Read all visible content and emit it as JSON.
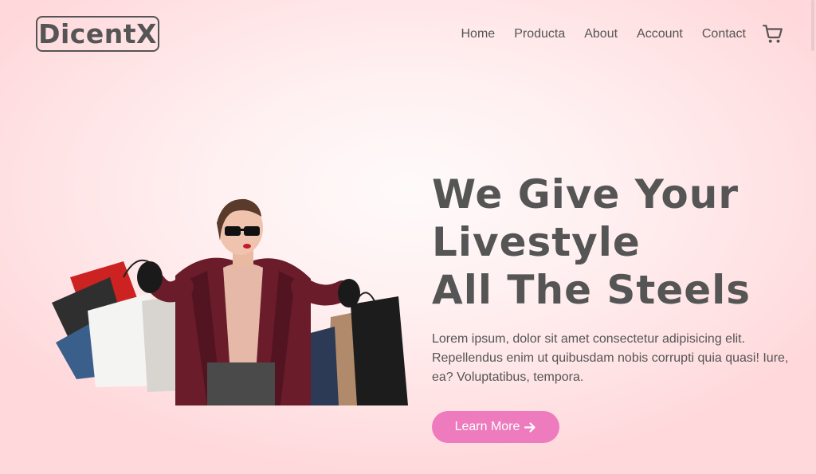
{
  "brand": {
    "logo_text": "DicentX"
  },
  "nav": {
    "items": [
      {
        "label": "Home"
      },
      {
        "label": "Producta"
      },
      {
        "label": "About"
      },
      {
        "label": "Account"
      },
      {
        "label": "Contact"
      }
    ],
    "cart_icon": "cart-icon"
  },
  "hero": {
    "title_lines": [
      "We Give Your",
      "Livestyle",
      "All The Steels"
    ],
    "text": "Lorem ipsum, dolor sit amet consectetur adipisicing elit. Repellendus enim ut quibusdam nobis corrupti quia quasi! Iure, ea? Voluptatibus, tempora.",
    "button_label": "Learn More",
    "button_icon": "arrow-right-icon",
    "image_subject": "shopping-woman-image"
  },
  "colors": {
    "text": "#555555",
    "button": "#ee7bbd",
    "background": "#ffe1e3"
  }
}
